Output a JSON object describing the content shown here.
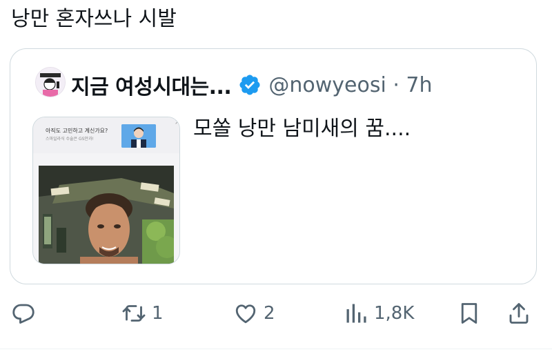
{
  "tweet": {
    "text": "낭만 혼자쓰나 시발"
  },
  "quote": {
    "display_name": "지금 여성시대는...",
    "handle_time": "@nowyeosi · 7h",
    "text": "모쏠 낭만 남미새의 꿈....",
    "media": {
      "ad_line1": "아직도 고민하고 계신가요?",
      "ad_line2": "스마일라식 수술은 GS안과!",
      "ad_close": "×"
    }
  },
  "actions": {
    "reply_count": "",
    "retweet_count": "1",
    "like_count": "2",
    "views_count": "1,8K"
  },
  "colors": {
    "text": "#0f1419",
    "secondary": "#536471",
    "verified": "#1d9bf0",
    "border": "#cfd9de"
  }
}
